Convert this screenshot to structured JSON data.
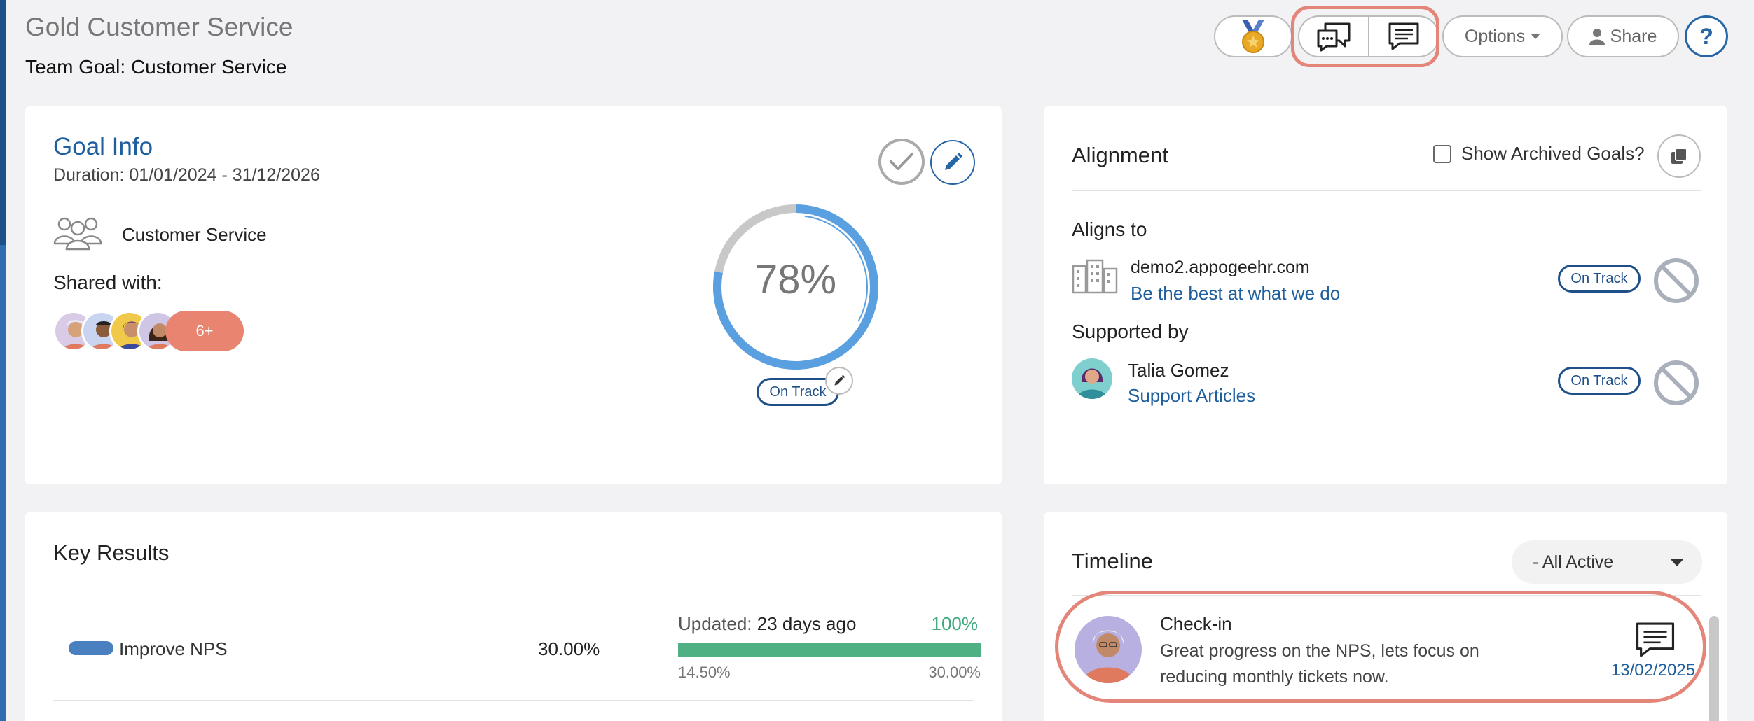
{
  "header": {
    "title": "Gold Customer Service",
    "subtitle": "Team Goal: Customer Service"
  },
  "toolbar": {
    "medal_icon": "medal-icon",
    "chat_icon": "chat-bubbles-icon",
    "comment_icon": "comment-icon",
    "options_label": "Options",
    "share_label": "Share",
    "help_label": "?"
  },
  "goal_info": {
    "heading": "Goal Info",
    "duration": "Duration: 01/01/2024 - 31/12/2026",
    "team_name": "Customer Service",
    "shared_label": "Shared with:",
    "more_count": "6+",
    "progress_percent": 78,
    "progress_label": "78%",
    "status": "On Track"
  },
  "alignment": {
    "heading": "Alignment",
    "show_archived_label": "Show Archived Goals?",
    "aligns_to_label": "Aligns to",
    "aligns_to": {
      "org": "demo2.appogeehr.com",
      "goal": "Be the best at what we do",
      "status": "On Track"
    },
    "supported_by_label": "Supported by",
    "supported_by": {
      "person": "Talia Gomez",
      "goal": "Support Articles",
      "status": "On Track"
    }
  },
  "key_results": {
    "heading": "Key Results",
    "rows": [
      {
        "name": "Improve NPS",
        "target": "30.00%",
        "updated_label": "Updated:",
        "updated_value": "23 days ago",
        "percent_label": "100%",
        "progress": 1.0,
        "min": "14.50%",
        "max": "30.00%"
      }
    ]
  },
  "timeline": {
    "heading": "Timeline",
    "filter_selected": "- All Active",
    "entries": [
      {
        "type": "Check-in",
        "text": "Great progress on the NPS, lets focus on reducing monthly tickets now.",
        "date": "13/02/2025"
      }
    ]
  },
  "colors": {
    "accent_blue": "#1f5f9e",
    "ring_blue": "#5aa0e0",
    "ring_gray": "#c8c8c8",
    "success_green": "#4eb083",
    "highlight_salmon": "#e4857a",
    "pill_salmon": "#e8846f"
  }
}
